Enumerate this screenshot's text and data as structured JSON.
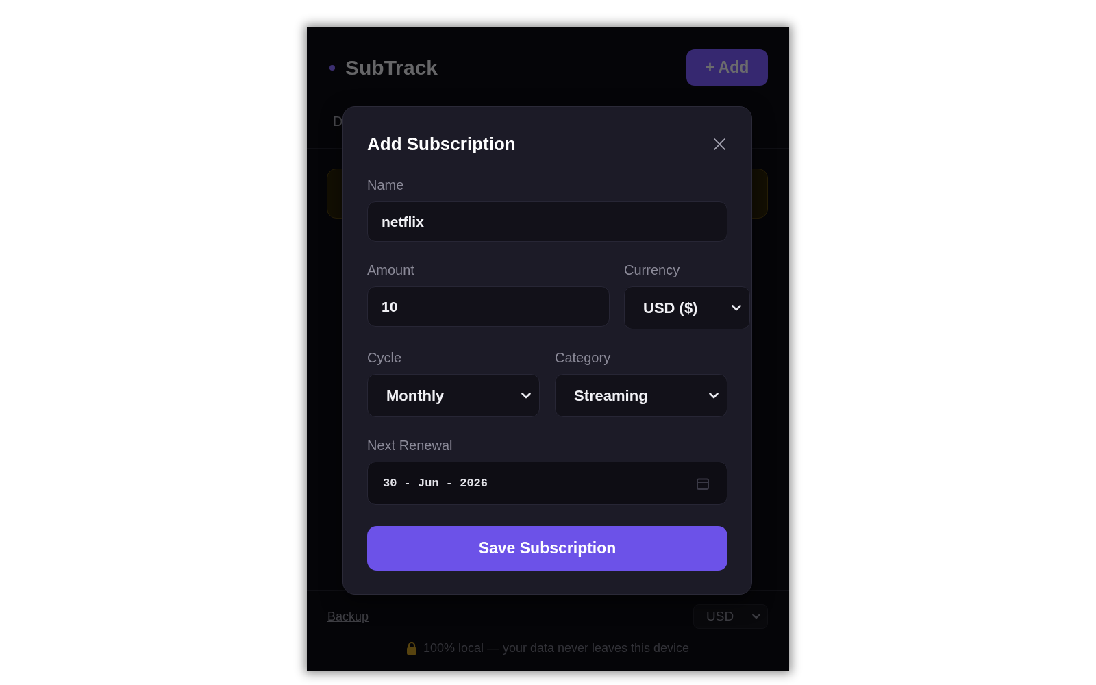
{
  "app": {
    "title": "SubTrack",
    "add_button": "+ Add"
  },
  "tabs": [
    {
      "label": "D"
    }
  ],
  "modal": {
    "title": "Add Subscription",
    "rows": [
      [
        {
          "label": "Name",
          "kind": "text",
          "value": "netflix"
        }
      ],
      [
        {
          "label": "Amount",
          "kind": "text",
          "value": "10"
        },
        {
          "label": "Currency",
          "kind": "select",
          "value": "USD ($)"
        }
      ],
      [
        {
          "label": "Cycle",
          "kind": "select",
          "value": "Monthly"
        },
        {
          "label": "Category",
          "kind": "select",
          "value": "Streaming"
        }
      ],
      [
        {
          "label": "Next Renewal",
          "kind": "date",
          "value": "30 - Jun - 2026"
        }
      ]
    ],
    "save_button": "Save Subscription"
  },
  "footer": {
    "backup_link": "Backup",
    "currency_select": "USD",
    "privacy_note": "100% local — your data never leaves this device"
  }
}
